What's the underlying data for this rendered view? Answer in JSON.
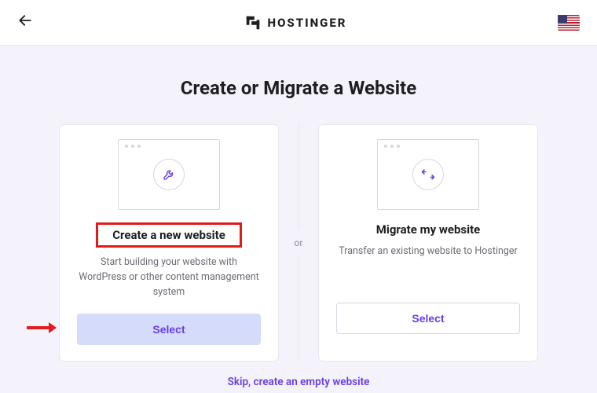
{
  "header": {
    "brand": "HOSTINGER"
  },
  "page": {
    "title": "Create or Migrate a Website",
    "separator": "or",
    "skip": "Skip, create an empty website"
  },
  "cards": {
    "create": {
      "title": "Create a new website",
      "desc": "Start building your website with WordPress or other content management system",
      "button": "Select"
    },
    "migrate": {
      "title": "Migrate my website",
      "desc": "Transfer an existing website to Hostinger",
      "button": "Select"
    }
  }
}
